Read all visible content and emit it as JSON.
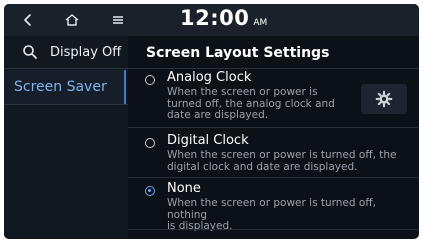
{
  "topbar": {
    "back_icon": "chevron-left-icon",
    "home_icon": "home-icon",
    "menu_icon": "menu-icon",
    "time": "12:00",
    "ampm": "AM"
  },
  "sidebar": {
    "search_icon": "search-icon",
    "display_off_label": "Display Off",
    "items": [
      {
        "label": "Screen Saver",
        "selected": true
      }
    ]
  },
  "main": {
    "title": "Screen Layout Settings",
    "options": [
      {
        "title": "Analog Clock",
        "desc_lines": [
          "When the screen or power is",
          "turned off, the analog clock and",
          "date are displayed."
        ],
        "selected": false,
        "has_settings": true,
        "settings_icon": "gear-icon"
      },
      {
        "title": "Digital Clock",
        "desc_lines": [
          "When the screen or power is turned off, the",
          "digital clock and date are displayed."
        ],
        "selected": false
      },
      {
        "title": "None",
        "desc_lines": [
          "When the screen or power is turned off, nothing",
          "is displayed."
        ],
        "selected": true
      }
    ]
  },
  "colors": {
    "background": "#0c1118",
    "topbar": "#1b212b",
    "accent": "#6aaaf0",
    "sidebar_selected_text": "#7fb4ea"
  }
}
